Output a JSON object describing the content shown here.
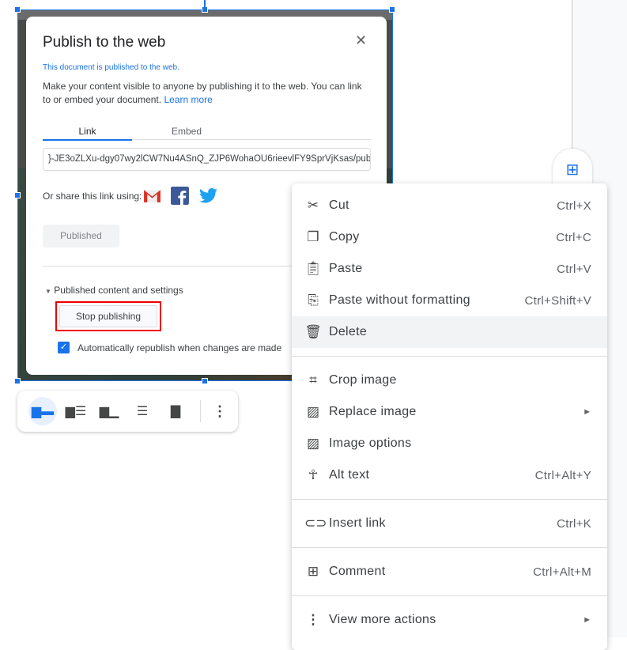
{
  "dialog": {
    "title": "Publish to the web",
    "status": "This document is published to the web.",
    "description": "Make your content visible to anyone by publishing it to the web. You can link to or embed your document.",
    "learn_more": "Learn more",
    "tabs": [
      "Link",
      "Embed"
    ],
    "url": "}-JE3oZLXu-dgy07wy2lCW7Nu4ASnQ_ZJP6WohaOU6rieevlFY9SprVjKsas/pub",
    "share_label": "Or share this link using:",
    "published_button": "Published",
    "section_label": "Published content and settings",
    "stop_button": "Stop publishing",
    "auto_republish": "Automatically republish when changes are made",
    "auto_republish_checked": true,
    "highlight_color": "#ee0000"
  },
  "menu": {
    "items": [
      {
        "label": "Cut",
        "shortcut": "Ctrl+X",
        "icon": "scissors-icon"
      },
      {
        "label": "Copy",
        "shortcut": "Ctrl+C",
        "icon": "copy-icon"
      },
      {
        "label": "Paste",
        "shortcut": "Ctrl+V",
        "icon": "clipboard-icon"
      },
      {
        "label": "Paste without formatting",
        "shortcut": "Ctrl+Shift+V",
        "icon": "clipboard-clear-icon"
      },
      {
        "label": "Delete",
        "shortcut": "",
        "icon": "trash-icon"
      },
      {
        "label": "Crop image",
        "shortcut": "",
        "icon": "crop-icon"
      },
      {
        "label": "Replace image",
        "shortcut": "",
        "icon": "image-icon"
      },
      {
        "label": "Image options",
        "shortcut": "",
        "icon": "image-icon"
      },
      {
        "label": "Alt text",
        "shortcut": "Ctrl+Alt+Y",
        "icon": "accessibility-icon"
      },
      {
        "label": "Insert link",
        "shortcut": "Ctrl+K",
        "icon": "link-icon"
      },
      {
        "label": "Comment",
        "shortcut": "Ctrl+Alt+M",
        "icon": "add-comment-icon"
      },
      {
        "label": "View more actions",
        "shortcut": "",
        "icon": "more-vert-icon"
      }
    ]
  },
  "accent": "#1a73e8"
}
